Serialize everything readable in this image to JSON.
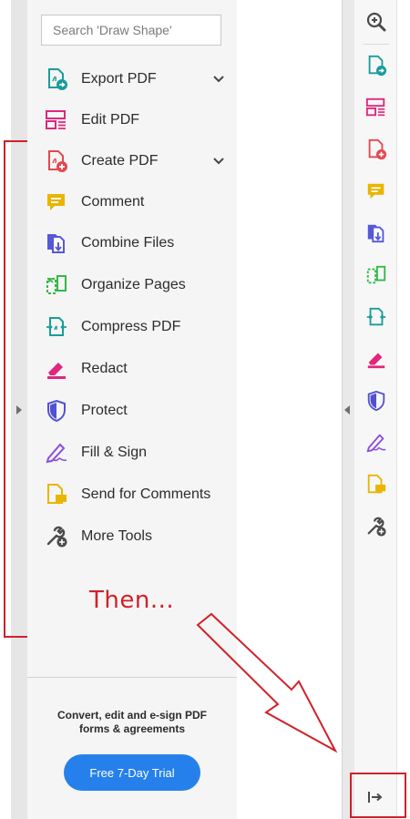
{
  "search": {
    "placeholder": "Search 'Draw Shape'"
  },
  "tools": [
    {
      "label": "Export PDF",
      "icon": "export-pdf-icon",
      "has_submenu": true
    },
    {
      "label": "Edit PDF",
      "icon": "edit-pdf-icon",
      "has_submenu": false
    },
    {
      "label": "Create PDF",
      "icon": "create-pdf-icon",
      "has_submenu": true
    },
    {
      "label": "Comment",
      "icon": "comment-icon",
      "has_submenu": false
    },
    {
      "label": "Combine Files",
      "icon": "combine-files-icon",
      "has_submenu": false
    },
    {
      "label": "Organize Pages",
      "icon": "organize-pages-icon",
      "has_submenu": false
    },
    {
      "label": "Compress PDF",
      "icon": "compress-pdf-icon",
      "has_submenu": false
    },
    {
      "label": "Redact",
      "icon": "redact-icon",
      "has_submenu": false
    },
    {
      "label": "Protect",
      "icon": "protect-icon",
      "has_submenu": false
    },
    {
      "label": "Fill & Sign",
      "icon": "fill-sign-icon",
      "has_submenu": false
    },
    {
      "label": "Send for Comments",
      "icon": "send-comments-icon",
      "has_submenu": false
    },
    {
      "label": "More Tools",
      "icon": "more-tools-icon",
      "has_submenu": false
    }
  ],
  "annotation": {
    "text": "Then..."
  },
  "promo": {
    "line1": "Convert, edit and e-sign PDF",
    "line2": "forms & agreements",
    "button": "Free 7-Day Trial"
  },
  "colors": {
    "accent_blue": "#2680eb",
    "annotation_red": "#d0212a",
    "export_teal": "#1a9c9c",
    "edit_pink": "#e0267d",
    "create_red": "#e34850",
    "comment_yellow": "#e8b500",
    "combine_purple": "#5558d9",
    "organize_green": "#33b84a",
    "protect_indigo": "#5151d3",
    "fill_purple": "#8a4fd8"
  }
}
